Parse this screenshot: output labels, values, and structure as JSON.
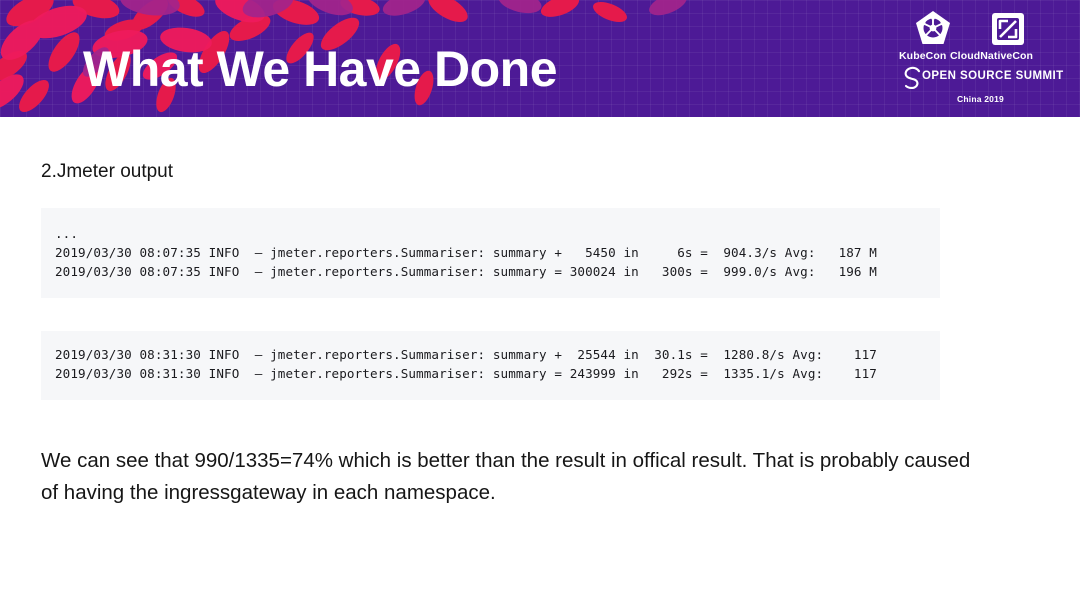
{
  "header": {
    "title": "What We Have Done",
    "background_color": "#4d1a96",
    "logo": {
      "kubecon_label": "KubeCon",
      "cloudnativecon_label": "CloudNativeCon",
      "summit_label": "OPEN SOURCE SUMMIT",
      "year_label": "China 2019"
    }
  },
  "slide": {
    "section_heading": "2.Jmeter output",
    "code_block_1": {
      "lines": [
        "...",
        "2019/03/30 08:07:35 INFO  – jmeter.reporters.Summariser: summary +   5450 in     6s =  904.3/s Avg:   187 M",
        "2019/03/30 08:07:35 INFO  – jmeter.reporters.Summariser: summary = 300024 in   300s =  999.0/s Avg:   196 M"
      ]
    },
    "code_block_2": {
      "lines": [
        "2019/03/30 08:31:30 INFO  – jmeter.reporters.Summariser: summary +  25544 in  30.1s =  1280.8/s Avg:    117",
        "2019/03/30 08:31:30 INFO  – jmeter.reporters.Summariser: summary = 243999 in   292s =  1335.1/s Avg:    117"
      ]
    },
    "paragraph": "We can see that 990/1335=74% which is better than the result in offical result. That is probably caused of having the ingressgateway in each namespace."
  }
}
